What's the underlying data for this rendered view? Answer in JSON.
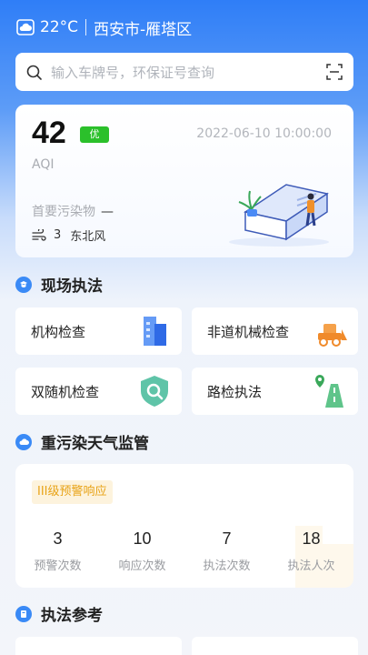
{
  "header": {
    "temperature": "22°C",
    "location": "西安市-雁塔区",
    "weather_icon": "cloud-icon"
  },
  "search": {
    "placeholder": "输入车牌号，环保证号查询"
  },
  "aqi": {
    "value": "42",
    "level": "优",
    "label": "AQI",
    "datetime": "2022-06-10 10:00:00",
    "primary_pollutant_label": "首要污染物",
    "primary_pollutant_value": "—",
    "wind_level": "3",
    "wind_direction": "东北风"
  },
  "field_enforcement": {
    "title": "现场执法",
    "tiles": [
      {
        "label": "机构检查",
        "icon": "building-icon"
      },
      {
        "label": "非道机械检查",
        "icon": "bulldozer-icon"
      },
      {
        "label": "双随机检查",
        "icon": "shield-search-icon"
      },
      {
        "label": "路检执法",
        "icon": "road-pin-icon"
      }
    ]
  },
  "pollution_weather": {
    "title": "重污染天气监管",
    "warning_level": "III级预警响应",
    "stats": [
      {
        "value": "3",
        "label": "预警次数"
      },
      {
        "value": "10",
        "label": "响应次数"
      },
      {
        "value": "7",
        "label": "执法次数"
      },
      {
        "value": "18",
        "label": "执法人次"
      }
    ]
  },
  "law_reference": {
    "title": "执法参考"
  },
  "colors": {
    "primary": "#2f7ef7",
    "good_green": "#2bc02b",
    "warning_orange": "#e8a317"
  }
}
